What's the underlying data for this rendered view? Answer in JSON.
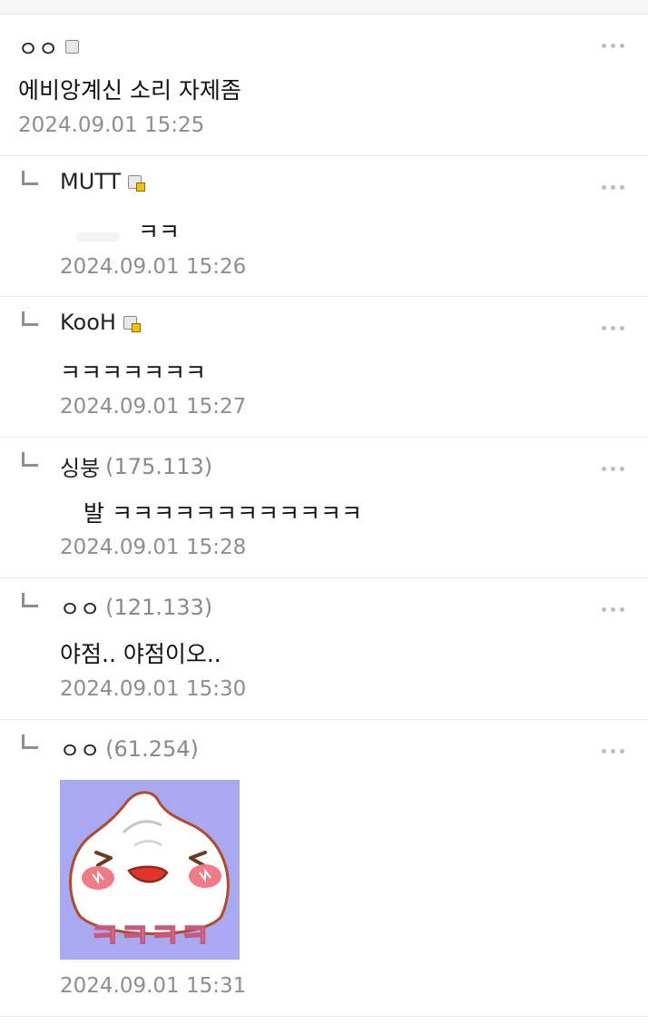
{
  "comments": [
    {
      "nick": "ㅇㅇ",
      "ip": "",
      "text": "에비앙계신 소리 자제좀",
      "date": "2024.09.01 15:25"
    },
    {
      "nick": "MUTT",
      "ip": "",
      "text": "ㅋㅋ",
      "date": "2024.09.01 15:26"
    },
    {
      "nick": "KooH",
      "ip": "",
      "text": "ㅋㅋㅋㅋㅋㅋㅋ",
      "date": "2024.09.01 15:27"
    },
    {
      "nick": "싱붕",
      "ip": "(175.113)",
      "text": "발 ㅋㅋㅋㅋㅋㅋㅋㅋㅋㅋㅋㅋ",
      "date": "2024.09.01 15:28"
    },
    {
      "nick": "ㅇㅇ",
      "ip": "(121.133)",
      "text": "야점.. 야점이오..",
      "date": "2024.09.01 15:30"
    },
    {
      "nick": "ㅇㅇ",
      "ip": "(61.254)",
      "text": "",
      "date": "2024.09.01 15:31",
      "emoticon_text": "ㅋㅋㅋㅋ"
    }
  ],
  "colors": {
    "text": "#1a1a1a",
    "meta": "#8e8e8e",
    "divider": "#e9e9e9",
    "emoticon_bg": "#a9a9f2",
    "blush": "#f07a86"
  },
  "icons": {
    "more": "more-dots-icon",
    "reply": "reply-arrow-icon",
    "badge": "member-badge-icon"
  }
}
